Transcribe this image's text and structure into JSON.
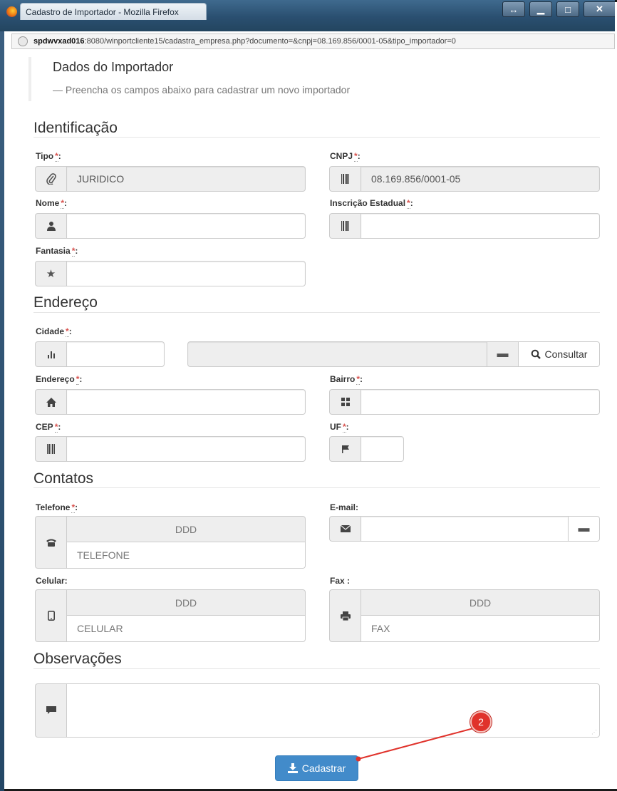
{
  "window": {
    "title": "Cadastro de Importador - Mozilla Firefox",
    "url_host": "spdwvxad016",
    "url_rest": ":8080/winportcliente15/cadastra_empresa.php?documento=&cnpj=08.169.856/0001-05&tipo_importador=0"
  },
  "header": {
    "title": "Dados do Importador",
    "subtitle": "— Preencha os campos abaixo para cadastrar um novo importador"
  },
  "sections": {
    "identificacao": "Identificação",
    "endereco": "Endereço",
    "contatos": "Contatos",
    "observacoes": "Observações"
  },
  "required_mark": "*",
  "fields": {
    "tipo": {
      "label": "Tipo",
      "suffix": ":",
      "value": "JURIDICO"
    },
    "cnpj": {
      "label": "CNPJ",
      "suffix": ":",
      "value": "08.169.856/0001-05"
    },
    "nome": {
      "label": "Nome",
      "suffix": ":",
      "value": ""
    },
    "inscricao": {
      "label": "Inscrição Estadual",
      "suffix": ":",
      "value": ""
    },
    "fantasia": {
      "label": "Fantasia",
      "suffix": ":",
      "value": ""
    },
    "cidade": {
      "label": "Cidade",
      "suffix": ":",
      "value": "",
      "consultar": "Consultar"
    },
    "endereco": {
      "label": "Endereço",
      "suffix": ":",
      "value": ""
    },
    "bairro": {
      "label": "Bairro",
      "suffix": ":",
      "value": ""
    },
    "cep": {
      "label": "CEP",
      "suffix": ":",
      "value": ""
    },
    "uf": {
      "label": "UF",
      "suffix": ":",
      "value": ""
    },
    "telefone": {
      "label": "Telefone",
      "suffix": ":",
      "ddd": "DDD",
      "placeholder": "TELEFONE"
    },
    "email": {
      "label": "E-mail:",
      "value": ""
    },
    "celular": {
      "label": "Celular:",
      "ddd": "DDD",
      "placeholder": "CELULAR"
    },
    "fax": {
      "label": "Fax :",
      "ddd": "DDD",
      "placeholder": "FAX"
    }
  },
  "submit_label": "Cadastrar",
  "annotation_badge": "2",
  "colors": {
    "primary": "#428bca",
    "required": "#d9534f",
    "badge": "#e0322b"
  }
}
